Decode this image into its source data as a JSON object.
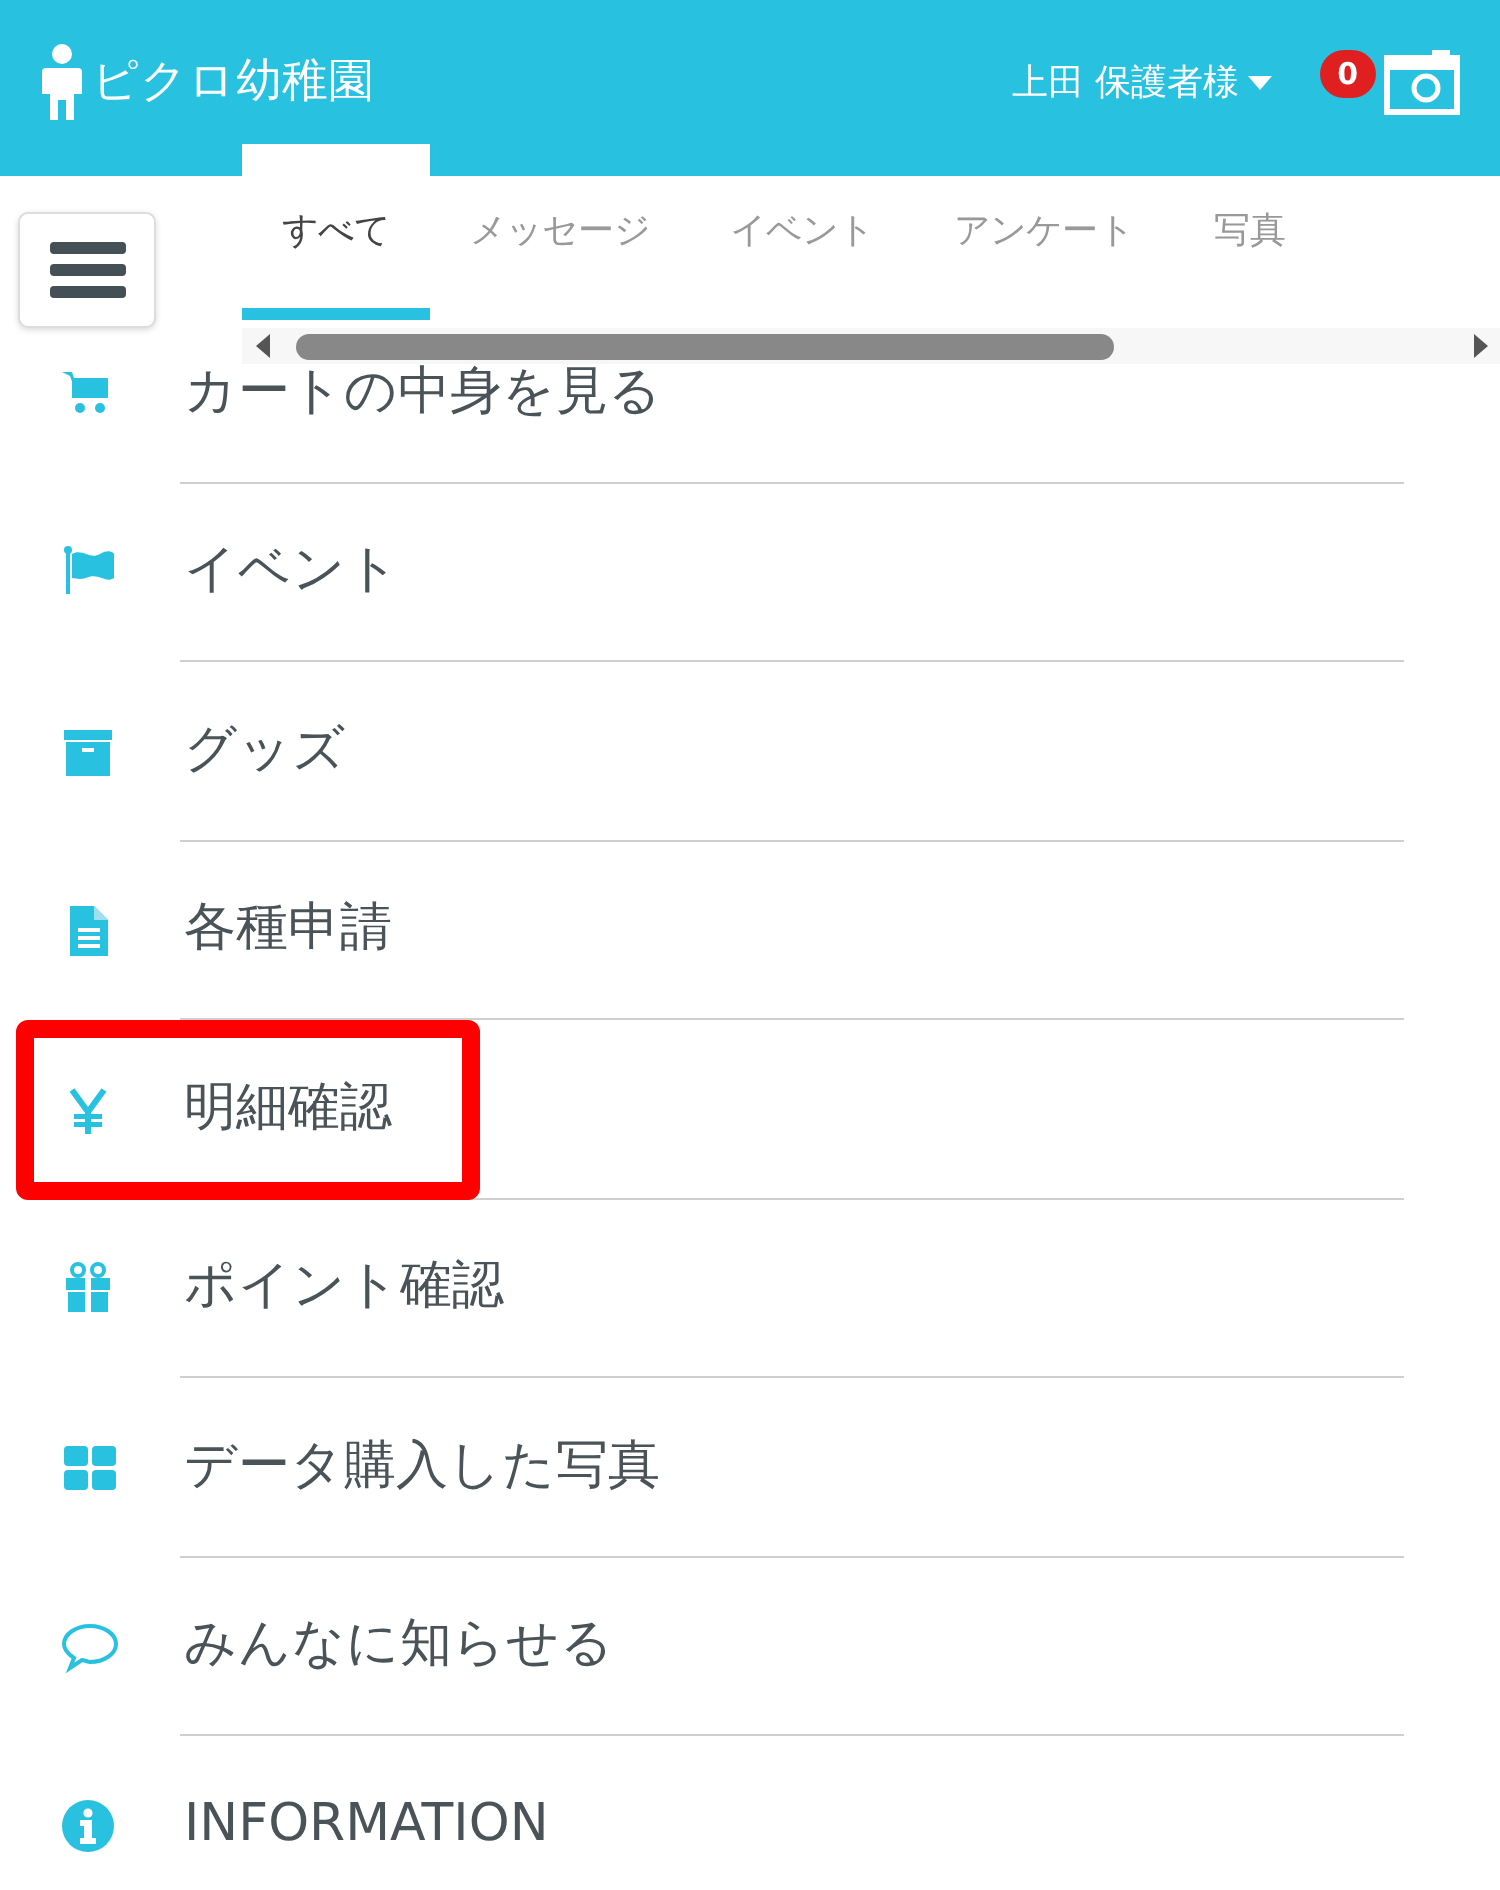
{
  "header": {
    "school_name": "ピクロ幼稚園",
    "user_name": "上田 保護者様",
    "notification_count": "0"
  },
  "tabs": [
    {
      "label": "すべて",
      "selected": true
    },
    {
      "label": "メッセージ",
      "selected": false
    },
    {
      "label": "イベント",
      "selected": false
    },
    {
      "label": "アンケート",
      "selected": false
    },
    {
      "label": "写真",
      "selected": false
    }
  ],
  "menu_items": [
    {
      "label": "カートの中身を見る",
      "highlighted": false
    },
    {
      "label": "イベント",
      "highlighted": false
    },
    {
      "label": "グッズ",
      "highlighted": false
    },
    {
      "label": "各種申請",
      "highlighted": false
    },
    {
      "label": "明細確認",
      "highlighted": true
    },
    {
      "label": "ポイント確認",
      "highlighted": false
    },
    {
      "label": "データ購入した写真",
      "highlighted": false
    },
    {
      "label": "みんなに知らせる",
      "highlighted": false
    },
    {
      "label": "INFORMATION",
      "highlighted": false
    }
  ]
}
